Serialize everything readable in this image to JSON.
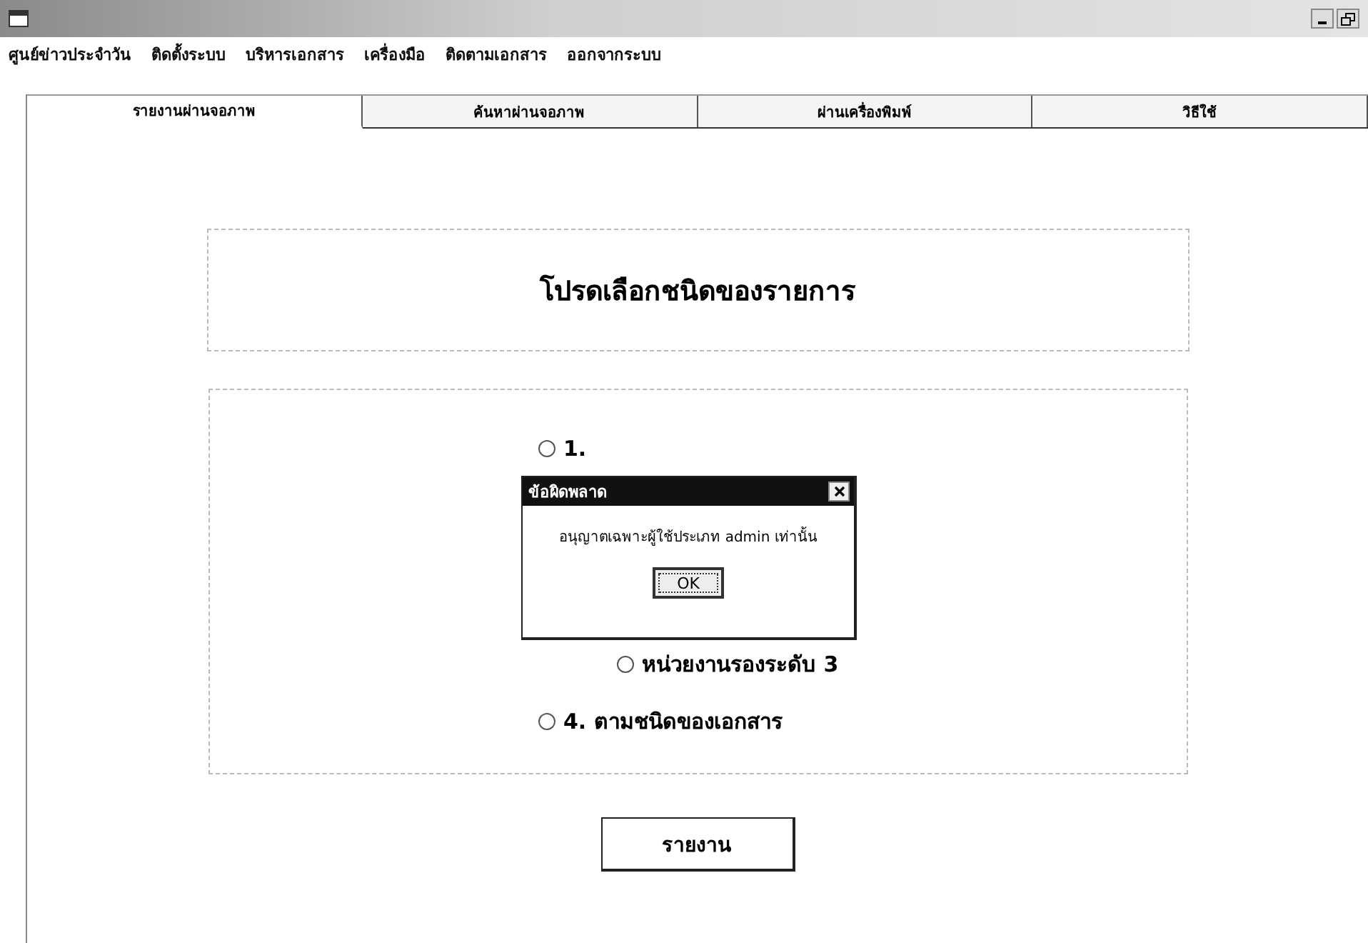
{
  "menu": [
    "ศูนย์ข่าวประจำวัน",
    "ติดตั้งระบบ",
    "บริหารเอกสาร",
    "เครื่องมือ",
    "ติดตามเอกสาร",
    "ออกจากระบบ"
  ],
  "tabs": [
    {
      "label": "รายงานผ่านจอภาพ",
      "selected": true
    },
    {
      "label": "ค้นหาผ่านจอภาพ",
      "selected": false
    },
    {
      "label": "ผ่านเครื่องพิมพ์",
      "selected": false
    },
    {
      "label": "วิธีใช้",
      "selected": false
    }
  ],
  "heading": "โปรดเลือกชนิดของรายการ",
  "options": [
    {
      "label": "1.",
      "selected": false
    },
    {
      "label": "หน่วยงานรองระดับ 3",
      "selected": false
    },
    {
      "label": "4. ตามชนิดของเอกสาร",
      "selected": false
    }
  ],
  "report_button": "รายงาน",
  "dialog": {
    "title": "ข้อผิดพลาด",
    "message": "อนุญาตเฉพาะผู้ใช้ประเภท admin เท่านั้น",
    "button": "OK"
  }
}
